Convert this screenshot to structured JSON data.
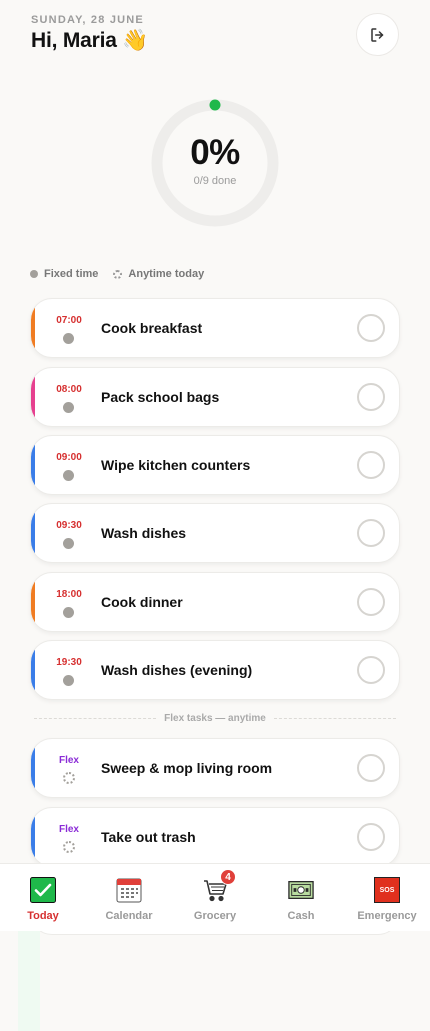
{
  "header": {
    "date": "SUNDAY, 28 JUNE",
    "greeting": "Hi, Maria 👋"
  },
  "progress": {
    "percent_label": "0%",
    "done_label": "0/9 done",
    "fraction": 0
  },
  "legend": {
    "fixed": "Fixed time",
    "anytime": "Anytime today"
  },
  "tasks": [
    {
      "time": "07:00",
      "title": "Cook breakfast",
      "color": "#f07c22"
    },
    {
      "time": "08:00",
      "title": "Pack school bags",
      "color": "#e6408f"
    },
    {
      "time": "09:00",
      "title": "Wipe kitchen counters",
      "color": "#3a7de8"
    },
    {
      "time": "09:30",
      "title": "Wash dishes",
      "color": "#3a7de8"
    },
    {
      "time": "18:00",
      "title": "Cook dinner",
      "color": "#f07c22"
    },
    {
      "time": "19:30",
      "title": "Wash dishes (evening)",
      "color": "#3a7de8"
    }
  ],
  "flex_divider": "Flex tasks — anytime",
  "flex_tasks": [
    {
      "tag": "Flex",
      "title": "Sweep & mop living room",
      "color": "#3a7de8"
    },
    {
      "tag": "Flex",
      "title": "Take out trash",
      "color": "#3a7de8"
    }
  ],
  "nav": {
    "today": "Today",
    "calendar": "Calendar",
    "grocery": "Grocery",
    "grocery_badge": "4",
    "cash": "Cash",
    "emergency": "Emergency",
    "sos": "SOS"
  },
  "colors": {
    "accent_red": "#d63030",
    "flex_purple": "#8a2bd6",
    "check_green": "#1fb84a"
  }
}
